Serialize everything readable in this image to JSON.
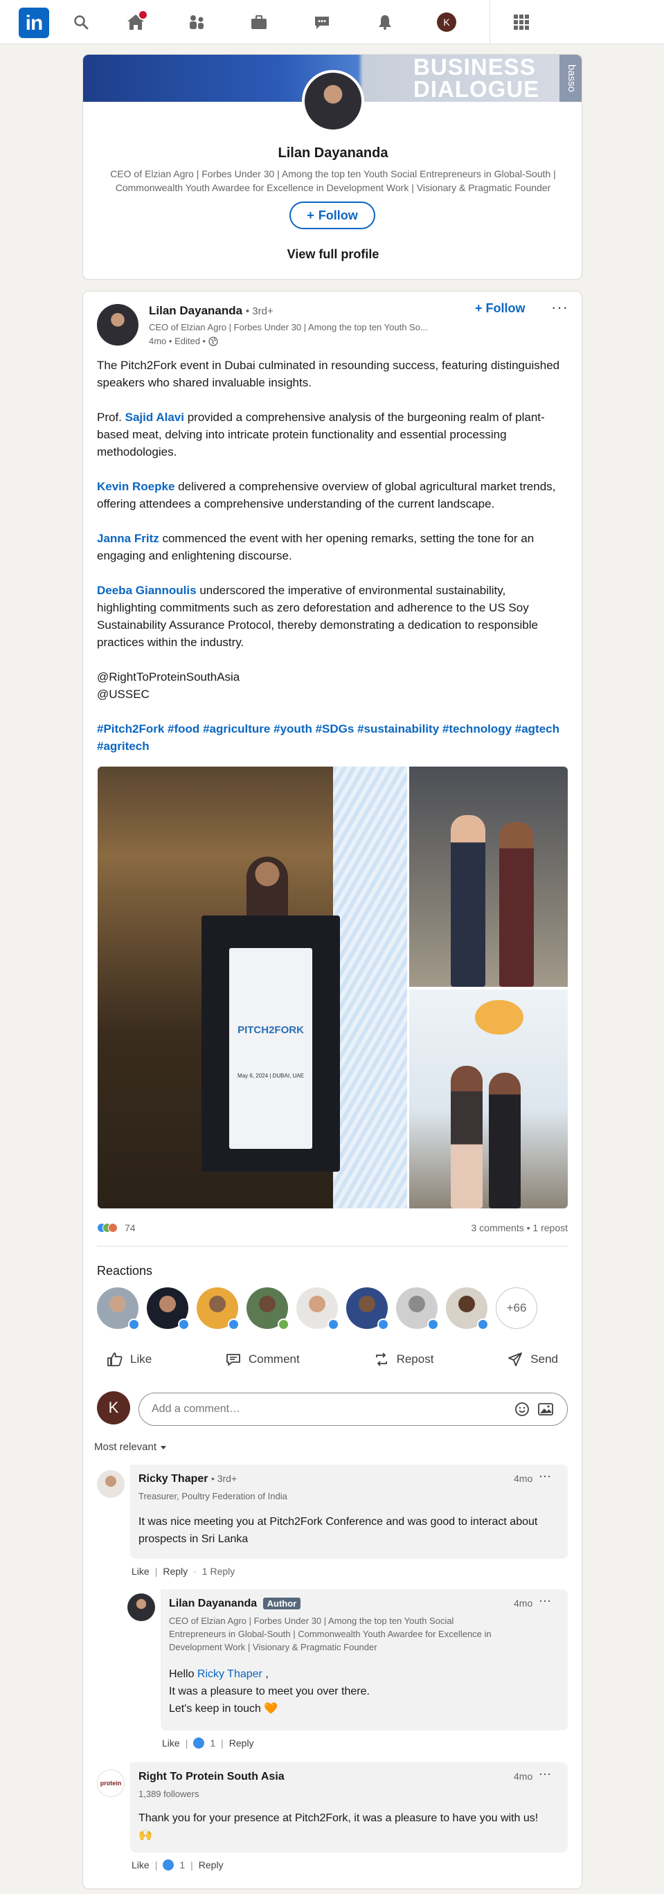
{
  "nav": {
    "logo": "in",
    "avatar_initial": "K"
  },
  "profile_card": {
    "banner_text_line1": "BUSINESS",
    "banner_text_line2": "DIALOGUE",
    "banner_side_text": "basso",
    "name": "Lilan Dayananda",
    "headline": "CEO of Elzian Agro | Forbes Under 30 | Among the top ten Youth Social Entrepreneurs in Global-South | Commonwealth Youth Awardee for Excellence in Development Work | Visionary & Pragmatic Founder",
    "follow_label": "Follow",
    "view_profile_label": "View full profile"
  },
  "post": {
    "author_name": "Lilan Dayananda",
    "author_degree": "• 3rd+",
    "author_headline": "CEO of Elzian Agro | Forbes Under 30 | Among the top ten Youth So...",
    "meta": "4mo • Edited •",
    "follow_label": "Follow",
    "more_label": "···",
    "paragraph1": "The Pitch2Fork event in Dubai culminated in resounding success, featuring distinguished speakers who shared invaluable insights.",
    "p2_prefix": "Prof. ",
    "p2_mention": "Sajid Alavi",
    "p2_text": " provided a comprehensive analysis of the burgeoning realm of plant-based meat, delving into intricate protein functionality and essential processing methodologies.",
    "p3_mention": "Kevin Roepke",
    "p3_text": " delivered a comprehensive overview of global agricultural market trends, offering attendees a comprehensive understanding of the current landscape.",
    "p4_mention": "Janna Fritz",
    "p4_text": " commenced the event with her opening remarks, setting the tone for an engaging and enlightening discourse.",
    "p5_mention": "Deeba Giannoulis",
    "p5_text": " underscored the imperative of environmental sustainability, highlighting commitments such as zero deforestation and adherence to the US Soy Sustainability Assurance Protocol, thereby demonstrating a dedication to responsible practices within the industry.",
    "handle1": "@RightToProteinSouthAsia",
    "handle2": "@USSEC",
    "hashtags": [
      "#Pitch2Fork",
      "#food",
      "#agriculture",
      "#youth",
      "#SDGs",
      "#sustainability",
      "#technology",
      "#agtech",
      "#agritech"
    ],
    "podium_text": "PITCH2FORK",
    "podium_date": "May 6, 2024 | DUBAI, UAE",
    "reaction_count": "74",
    "comments_reposts": "3 comments • 1 repost",
    "reactions_title": "Reactions",
    "more_reactors": "+66",
    "actions": {
      "like": "Like",
      "comment": "Comment",
      "repost": "Repost",
      "send": "Send"
    }
  },
  "comment_input": {
    "avatar_initial": "K",
    "placeholder": "Add a comment…"
  },
  "sort_label": "Most relevant",
  "comments": [
    {
      "name": "Ricky Thaper",
      "degree": "• 3rd+",
      "headline": "Treasurer, Poultry Federation of India",
      "time": "4mo",
      "text": "It was nice meeting you at Pitch2Fork Conference and was good to interact about prospects in Sri Lanka",
      "like": "Like",
      "reply": "Reply",
      "replies": "1 Reply"
    },
    {
      "name": "Lilan Dayananda",
      "badge": "Author",
      "headline": "CEO of Elzian Agro | Forbes Under 30 | Among the top ten Youth Social Entrepreneurs in Global-South | Commonwealth Youth Awardee for Excellence in Development Work | Visionary & Pragmatic Founder",
      "time": "4mo",
      "text_prefix": "Hello ",
      "text_mention": "Ricky Thaper",
      "text_suffix": " ,",
      "text_line2": "It was a pleasure to meet you over there.",
      "text_line3": "Let's keep in touch 🧡",
      "like": "Like",
      "like_count": "1",
      "reply": "Reply"
    },
    {
      "name": "Right To Protein South Asia",
      "headline": "1,389 followers",
      "time": "4mo",
      "text": "Thank you for your presence at Pitch2Fork, it was a pleasure to have you with us! 🙌",
      "like": "Like",
      "like_count": "1",
      "reply": "Reply",
      "logo_text": "protein"
    }
  ]
}
